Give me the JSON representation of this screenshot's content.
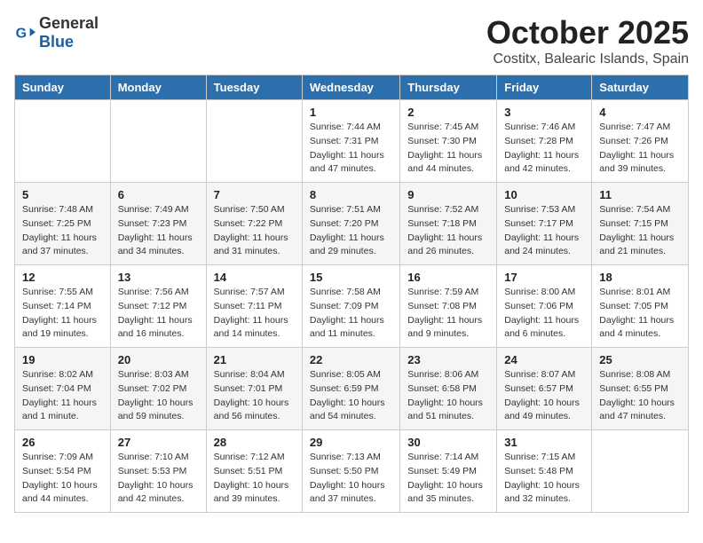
{
  "header": {
    "logo_general": "General",
    "logo_blue": "Blue",
    "month": "October 2025",
    "location": "Costitx, Balearic Islands, Spain"
  },
  "weekdays": [
    "Sunday",
    "Monday",
    "Tuesday",
    "Wednesday",
    "Thursday",
    "Friday",
    "Saturday"
  ],
  "weeks": [
    [
      {
        "day": "",
        "info": ""
      },
      {
        "day": "",
        "info": ""
      },
      {
        "day": "",
        "info": ""
      },
      {
        "day": "1",
        "info": "Sunrise: 7:44 AM\nSunset: 7:31 PM\nDaylight: 11 hours and 47 minutes."
      },
      {
        "day": "2",
        "info": "Sunrise: 7:45 AM\nSunset: 7:30 PM\nDaylight: 11 hours and 44 minutes."
      },
      {
        "day": "3",
        "info": "Sunrise: 7:46 AM\nSunset: 7:28 PM\nDaylight: 11 hours and 42 minutes."
      },
      {
        "day": "4",
        "info": "Sunrise: 7:47 AM\nSunset: 7:26 PM\nDaylight: 11 hours and 39 minutes."
      }
    ],
    [
      {
        "day": "5",
        "info": "Sunrise: 7:48 AM\nSunset: 7:25 PM\nDaylight: 11 hours and 37 minutes."
      },
      {
        "day": "6",
        "info": "Sunrise: 7:49 AM\nSunset: 7:23 PM\nDaylight: 11 hours and 34 minutes."
      },
      {
        "day": "7",
        "info": "Sunrise: 7:50 AM\nSunset: 7:22 PM\nDaylight: 11 hours and 31 minutes."
      },
      {
        "day": "8",
        "info": "Sunrise: 7:51 AM\nSunset: 7:20 PM\nDaylight: 11 hours and 29 minutes."
      },
      {
        "day": "9",
        "info": "Sunrise: 7:52 AM\nSunset: 7:18 PM\nDaylight: 11 hours and 26 minutes."
      },
      {
        "day": "10",
        "info": "Sunrise: 7:53 AM\nSunset: 7:17 PM\nDaylight: 11 hours and 24 minutes."
      },
      {
        "day": "11",
        "info": "Sunrise: 7:54 AM\nSunset: 7:15 PM\nDaylight: 11 hours and 21 minutes."
      }
    ],
    [
      {
        "day": "12",
        "info": "Sunrise: 7:55 AM\nSunset: 7:14 PM\nDaylight: 11 hours and 19 minutes."
      },
      {
        "day": "13",
        "info": "Sunrise: 7:56 AM\nSunset: 7:12 PM\nDaylight: 11 hours and 16 minutes."
      },
      {
        "day": "14",
        "info": "Sunrise: 7:57 AM\nSunset: 7:11 PM\nDaylight: 11 hours and 14 minutes."
      },
      {
        "day": "15",
        "info": "Sunrise: 7:58 AM\nSunset: 7:09 PM\nDaylight: 11 hours and 11 minutes."
      },
      {
        "day": "16",
        "info": "Sunrise: 7:59 AM\nSunset: 7:08 PM\nDaylight: 11 hours and 9 minutes."
      },
      {
        "day": "17",
        "info": "Sunrise: 8:00 AM\nSunset: 7:06 PM\nDaylight: 11 hours and 6 minutes."
      },
      {
        "day": "18",
        "info": "Sunrise: 8:01 AM\nSunset: 7:05 PM\nDaylight: 11 hours and 4 minutes."
      }
    ],
    [
      {
        "day": "19",
        "info": "Sunrise: 8:02 AM\nSunset: 7:04 PM\nDaylight: 11 hours and 1 minute."
      },
      {
        "day": "20",
        "info": "Sunrise: 8:03 AM\nSunset: 7:02 PM\nDaylight: 10 hours and 59 minutes."
      },
      {
        "day": "21",
        "info": "Sunrise: 8:04 AM\nSunset: 7:01 PM\nDaylight: 10 hours and 56 minutes."
      },
      {
        "day": "22",
        "info": "Sunrise: 8:05 AM\nSunset: 6:59 PM\nDaylight: 10 hours and 54 minutes."
      },
      {
        "day": "23",
        "info": "Sunrise: 8:06 AM\nSunset: 6:58 PM\nDaylight: 10 hours and 51 minutes."
      },
      {
        "day": "24",
        "info": "Sunrise: 8:07 AM\nSunset: 6:57 PM\nDaylight: 10 hours and 49 minutes."
      },
      {
        "day": "25",
        "info": "Sunrise: 8:08 AM\nSunset: 6:55 PM\nDaylight: 10 hours and 47 minutes."
      }
    ],
    [
      {
        "day": "26",
        "info": "Sunrise: 7:09 AM\nSunset: 5:54 PM\nDaylight: 10 hours and 44 minutes."
      },
      {
        "day": "27",
        "info": "Sunrise: 7:10 AM\nSunset: 5:53 PM\nDaylight: 10 hours and 42 minutes."
      },
      {
        "day": "28",
        "info": "Sunrise: 7:12 AM\nSunset: 5:51 PM\nDaylight: 10 hours and 39 minutes."
      },
      {
        "day": "29",
        "info": "Sunrise: 7:13 AM\nSunset: 5:50 PM\nDaylight: 10 hours and 37 minutes."
      },
      {
        "day": "30",
        "info": "Sunrise: 7:14 AM\nSunset: 5:49 PM\nDaylight: 10 hours and 35 minutes."
      },
      {
        "day": "31",
        "info": "Sunrise: 7:15 AM\nSunset: 5:48 PM\nDaylight: 10 hours and 32 minutes."
      },
      {
        "day": "",
        "info": ""
      }
    ]
  ]
}
